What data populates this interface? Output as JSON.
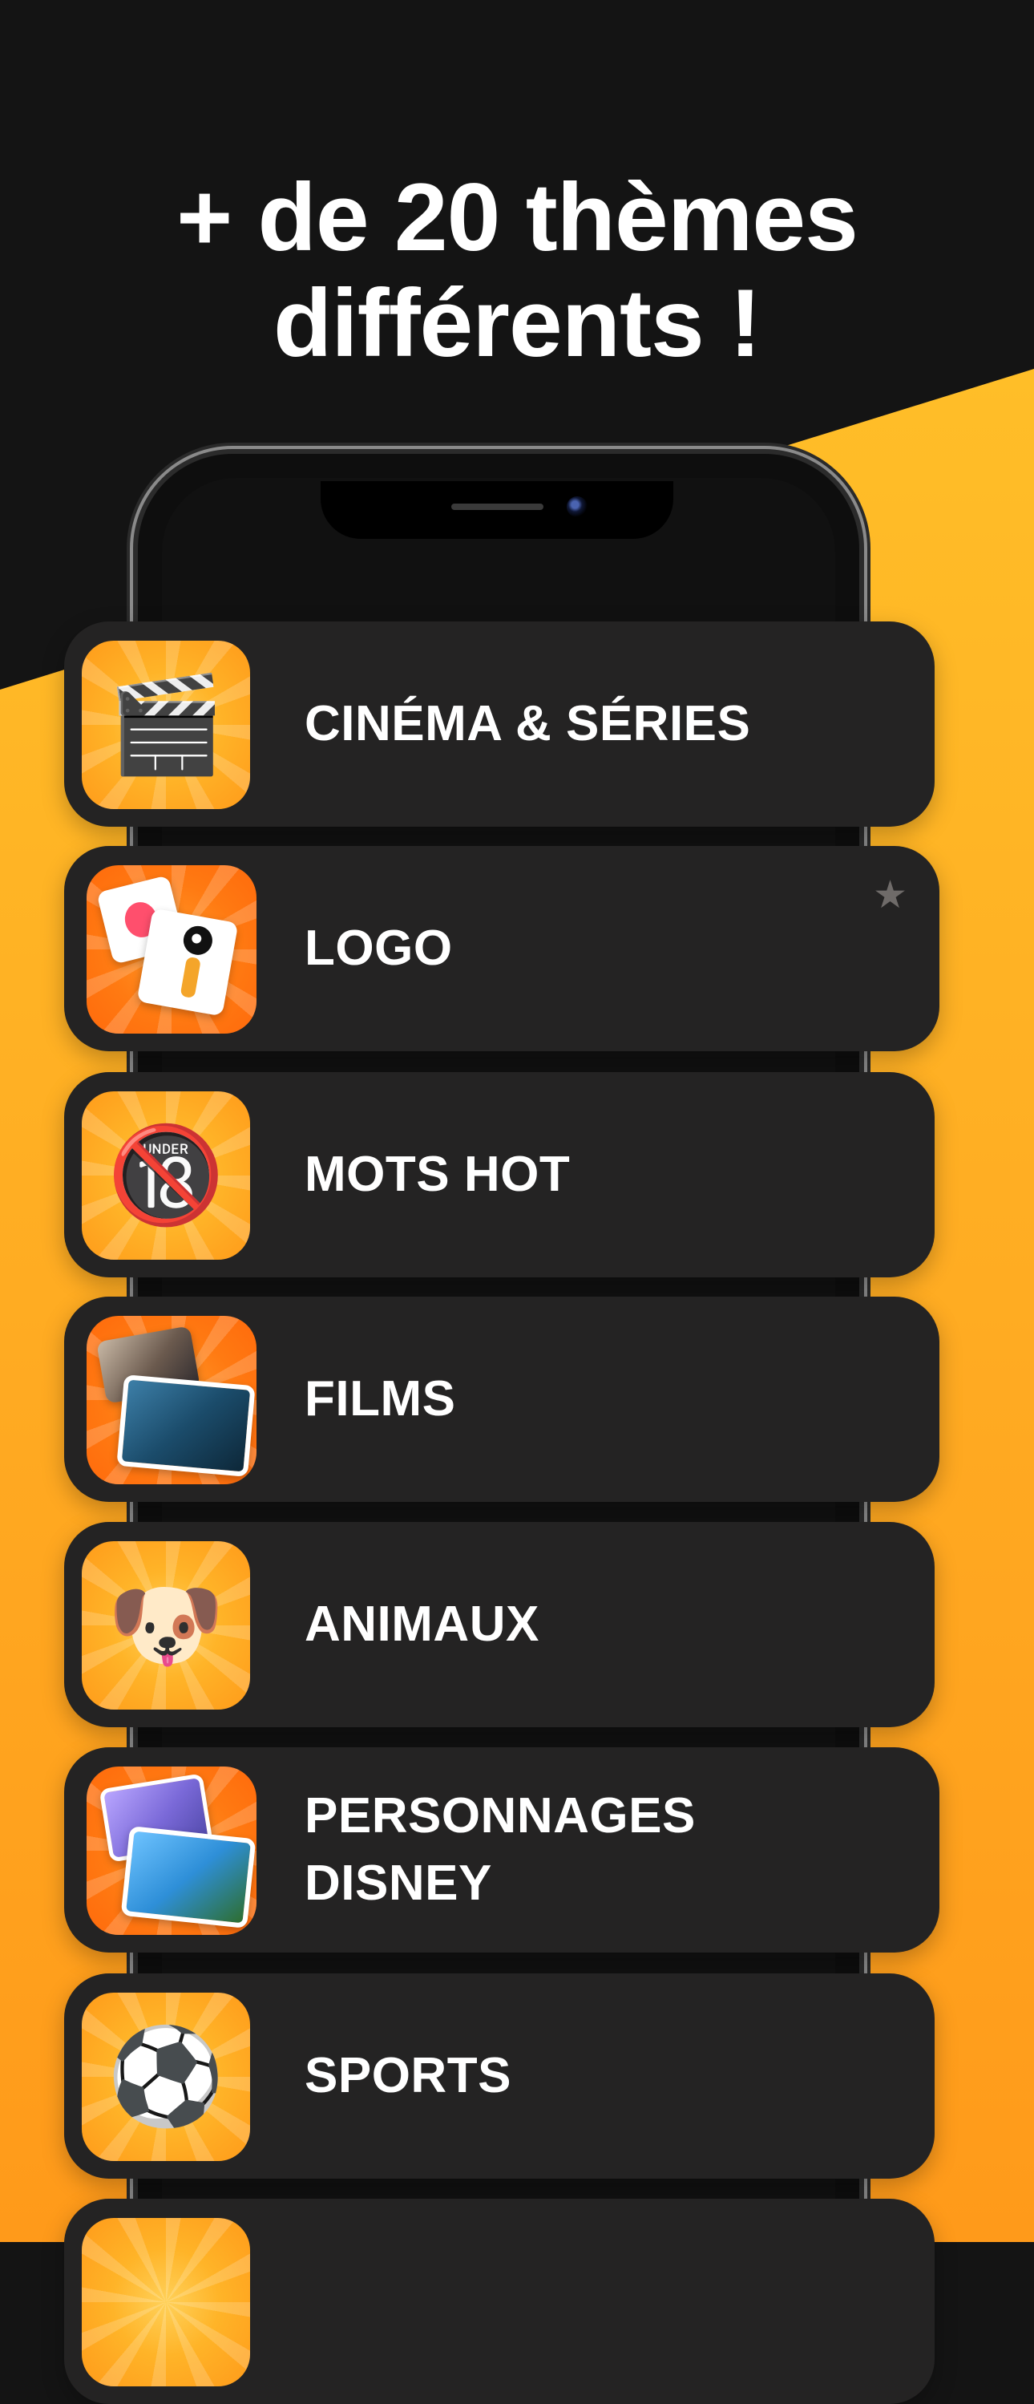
{
  "headline": {
    "line1": "+ de 20 thèmes",
    "line2": "différents !"
  },
  "colors": {
    "accent_yellow": "#ffc52a",
    "card_bg": "#242323",
    "top_bg": "#141414"
  },
  "categories": [
    {
      "label_line1": "CINÉMA & SÉRIES",
      "label_line2": "",
      "icon": "clapperboard-icon"
    },
    {
      "label_line1": "LOGO",
      "label_line2": "",
      "icon": "logo-cards-icon",
      "badge": "star-icon"
    },
    {
      "label_line1": "MOTS HOT",
      "label_line2": "",
      "icon": "no-under-18-icon"
    },
    {
      "label_line1": "FILMS",
      "label_line2": "",
      "icon": "film-photos-icon"
    },
    {
      "label_line1": "ANIMAUX",
      "label_line2": "",
      "icon": "dog-face-icon"
    },
    {
      "label_line1": "PERSONNAGES",
      "label_line2": "DISNEY",
      "icon": "disney-photos-icon"
    },
    {
      "label_line1": "SPORTS",
      "label_line2": "",
      "icon": "soccer-ball-icon"
    }
  ],
  "glyphs": {
    "clapper": "🎬",
    "no18": "🔞",
    "dog": "🐶",
    "ball": "⚽",
    "star": "★"
  }
}
